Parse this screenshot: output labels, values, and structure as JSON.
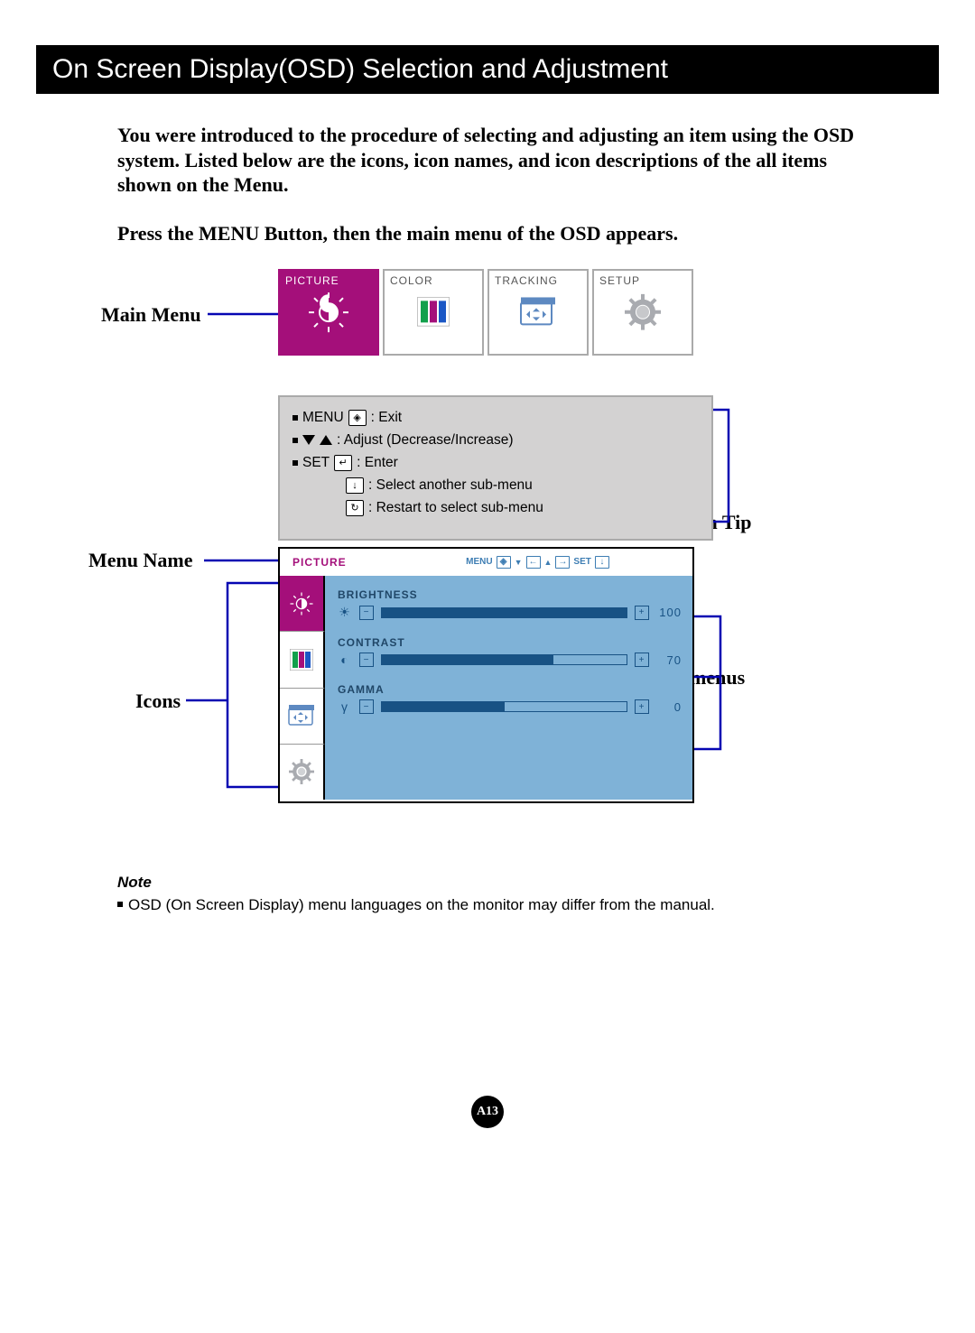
{
  "page_title": "On Screen Display(OSD) Selection and Adjustment",
  "intro_p1": "You were introduced to the procedure of selecting and adjusting an item using the OSD system.  Listed below are the icons, icon names, and icon descriptions of the all items shown on the Menu.",
  "intro_p2": "Press the MENU Button, then the main menu of the OSD appears.",
  "labels": {
    "main_menu": "Main Menu",
    "menu_name": "Menu Name",
    "icons": "Icons",
    "button_tip": "Button Tip",
    "sub_menus": "Sub-menus"
  },
  "tabs": [
    {
      "title": "PICTURE",
      "active": true
    },
    {
      "title": "COLOR",
      "active": false
    },
    {
      "title": "TRACKING",
      "active": false
    },
    {
      "title": "SETUP",
      "active": false
    }
  ],
  "tips": {
    "row1_a": "MENU",
    "row1_b": ": Exit",
    "row2": ": Adjust (Decrease/Increase)",
    "row3_a": "SET",
    "row3_b": ": Enter",
    "row4": ": Select another sub-menu",
    "row5": ": Restart to select sub-menu"
  },
  "osd": {
    "menu_name": "PICTURE",
    "header_keys": {
      "menu": "MENU",
      "set": "SET"
    },
    "items": [
      {
        "title": "BRIGHTNESS",
        "icon": "☀",
        "value": 100,
        "fill_pct": 100
      },
      {
        "title": "CONTRAST",
        "icon": "◐",
        "value": 70,
        "fill_pct": 70
      },
      {
        "title": "GAMMA",
        "icon": "γ",
        "value": 0,
        "fill_pct": 50
      }
    ]
  },
  "note_title": "Note",
  "note_text": "OSD (On Screen Display) menu languages on the monitor may differ from the manual.",
  "page_marker": "A13"
}
